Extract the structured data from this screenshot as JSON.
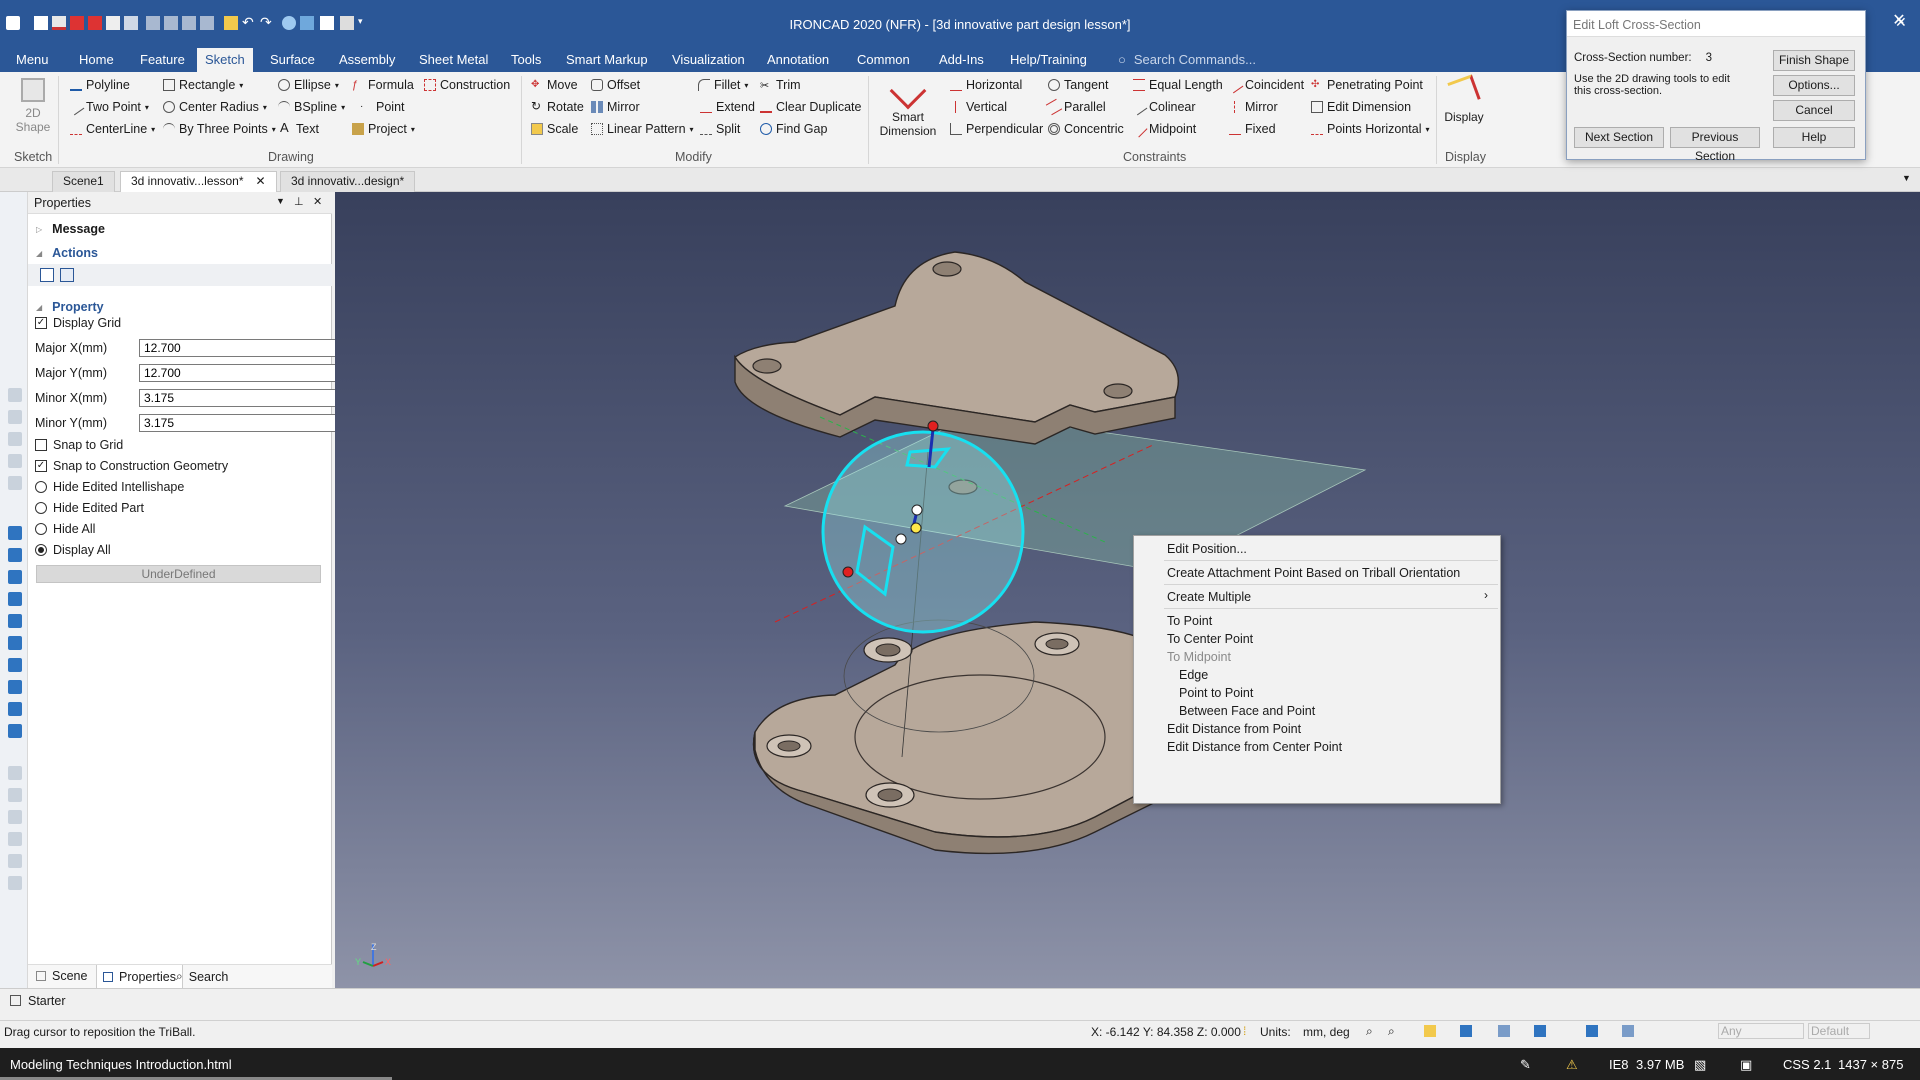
{
  "window": {
    "title": "IRONCAD 2020 (NFR) - [3d innovative part design lesson*]",
    "close_glyph": "✕"
  },
  "ribbon_tabs": [
    "Menu",
    "Home",
    "Feature",
    "Sketch",
    "Surface",
    "Assembly",
    "Sheet Metal",
    "Tools",
    "Smart Markup",
    "Visualization",
    "Annotation",
    "Common",
    "Add-Ins",
    "Help/Training"
  ],
  "active_tab": "Sketch",
  "search_placeholder": "Search Commands...",
  "ribbon": {
    "sketch_group": {
      "shape_button": "2D Shape",
      "label": "Sketch"
    },
    "drawing": {
      "label": "Drawing",
      "items": [
        "Polyline",
        "Rectangle",
        "Ellipse",
        "Formula",
        "Construction",
        "Two Point",
        "Center Radius",
        "BSpline",
        "Point",
        "CenterLine",
        "By Three Points",
        "Text",
        "Project"
      ]
    },
    "modify": {
      "label": "Modify",
      "items": [
        "Move",
        "Offset",
        "Fillet",
        "Trim",
        "Rotate",
        "Mirror",
        "Extend",
        "Clear Duplicate",
        "Scale",
        "Linear Pattern",
        "Split",
        "Find Gap"
      ]
    },
    "smart_dimension": "Smart Dimension",
    "constraints": {
      "label": "Constraints",
      "items": [
        "Horizontal",
        "Tangent",
        "Equal Length",
        "Coincident",
        "Penetrating Point",
        "Vertical",
        "Parallel",
        "Colinear",
        "Mirror",
        "Edit Dimension",
        "Perpendicular",
        "Concentric",
        "Midpoint",
        "Fixed",
        "Points Horizontal"
      ]
    },
    "display": {
      "button": "Display",
      "label": "Display"
    }
  },
  "doc_tabs": [
    "Scene1",
    "3d innovativ...lesson*",
    "3d innovativ...design*"
  ],
  "panel": {
    "title": "Properties",
    "sections": {
      "message": "Message",
      "actions": "Actions",
      "property": "Property"
    },
    "display_grid": "Display Grid",
    "fields": [
      {
        "label": "Major X(mm)",
        "value": "12.700"
      },
      {
        "label": "Major Y(mm)",
        "value": "12.700"
      },
      {
        "label": "Minor X(mm)",
        "value": "3.175"
      },
      {
        "label": "Minor Y(mm)",
        "value": "3.175"
      }
    ],
    "snap_to_grid": "Snap to Grid",
    "snap_to_construction": "Snap to Construction Geometry",
    "radios": [
      "Hide Edited Intellishape",
      "Hide Edited Part",
      "Hide All",
      "Display All"
    ],
    "selected_radio": "Display All",
    "status_button": "UnderDefined",
    "footer_tabs": [
      "Scene",
      "Properties",
      "Search"
    ]
  },
  "context_menu": {
    "items": [
      {
        "label": "Edit Position...",
        "disabled": false
      },
      {
        "label": "Create Attachment Point Based on Triball Orientation",
        "disabled": false
      },
      {
        "label": "Create Multiple",
        "disabled": false,
        "submenu": true
      },
      {
        "label": "To Point",
        "disabled": false
      },
      {
        "label": "To Center Point",
        "disabled": false
      },
      {
        "label": "To Midpoint",
        "disabled": true
      },
      {
        "label": "Edge",
        "disabled": false,
        "indent": true
      },
      {
        "label": "Point to Point",
        "disabled": false,
        "indent": true
      },
      {
        "label": "Between Face and Point",
        "disabled": false,
        "indent": true
      },
      {
        "label": "Edit Distance from Point",
        "disabled": false
      },
      {
        "label": "Edit Distance from Center Point",
        "disabled": false
      }
    ]
  },
  "loft_dialog": {
    "title": "Edit Loft Cross-Section",
    "cross_section_label": "Cross-Section number:",
    "cross_section_value": "3",
    "instructions": "Use the 2D drawing tools to edit this cross-section.",
    "buttons": [
      "Finish Shape",
      "Options...",
      "Cancel",
      "Next Section",
      "Previous Section",
      "Help"
    ]
  },
  "starter_label": "Starter",
  "status": {
    "message": "Drag cursor to reposition the TriBall.",
    "coords": "X: -6.142 Y: 84.358 Z: 0.000",
    "units_label": "Units:",
    "units_value": "mm, deg",
    "combo1": "Any",
    "combo2": "Default"
  },
  "taskbar": {
    "file": "Modeling Techniques Introduction.html",
    "ie": "IE8",
    "memory": "3.97 MB",
    "css": "CSS 2.1",
    "resolution": "1437 × 875"
  },
  "axis_labels": {
    "x": "X",
    "y": "Y",
    "z": "Z"
  }
}
